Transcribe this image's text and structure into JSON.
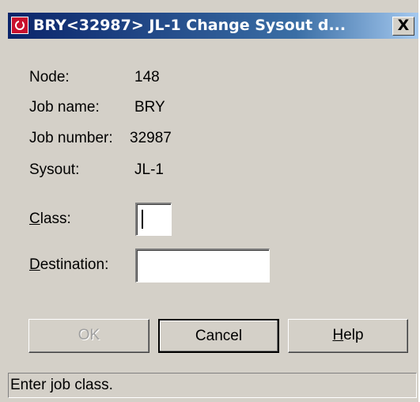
{
  "window": {
    "title": "BRY<32987> JL-1 Change Sysout d...",
    "close_glyph": "X",
    "icon": "app-red-icon"
  },
  "info": {
    "node_label": "Node:",
    "node_value": "148",
    "job_name_label": "Job name:",
    "job_name_value": "BRY",
    "job_number_label": "Job number:",
    "job_number_value": "32987",
    "sysout_label": "Sysout:",
    "sysout_value": "JL-1"
  },
  "form": {
    "class_label_mnemonic": "C",
    "class_label_rest": "lass:",
    "class_value": "",
    "destination_label_mnemonic": "D",
    "destination_label_rest": "estination:",
    "destination_value": ""
  },
  "buttons": {
    "ok_label": "OK",
    "cancel_label": "Cancel",
    "help_mnemonic": "H",
    "help_rest": "elp"
  },
  "status": {
    "text": "Enter job class."
  },
  "colors": {
    "titlebar_start": "#0a246a",
    "titlebar_end": "#a6caf0",
    "face": "#d4d0c8"
  }
}
